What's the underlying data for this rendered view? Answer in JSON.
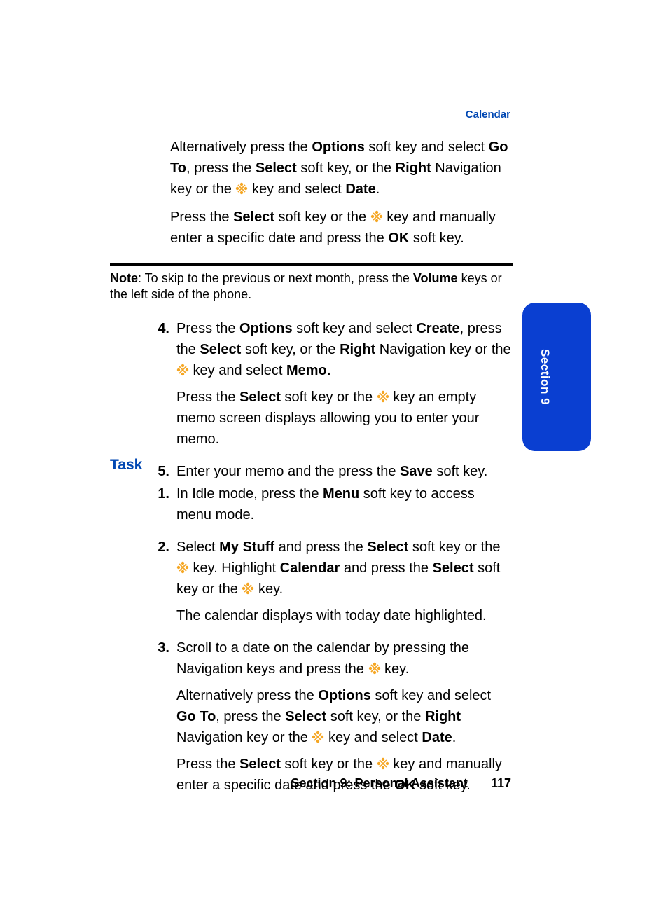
{
  "header": {
    "label": "Calendar"
  },
  "top": {
    "p1a": "Alternatively press the ",
    "p1b": "Options",
    "p1c": " soft key and select ",
    "p1d": "Go To",
    "p1e": ", press the ",
    "p1f": "Select",
    "p1g": " soft key, or the ",
    "p1h": "Right",
    "p1i": " Navigation key or the ",
    "p1j": " key and select ",
    "p1k": "Date",
    "p1l": ".",
    "p2a": "Press the ",
    "p2b": "Select",
    "p2c": " soft key or the ",
    "p2d": " key and manually enter a specific date and press the ",
    "p2e": "OK",
    "p2f": " soft key."
  },
  "note": {
    "label": "Note",
    "a": ": To skip to the previous or next month, press the ",
    "b": "Volume",
    "c": " keys or the left side of the phone."
  },
  "mid": {
    "n4": "4.",
    "s4a": "Press the ",
    "s4b": "Options",
    "s4c": " soft key and select ",
    "s4d": "Create",
    "s4e": ", press the ",
    "s4f": "Select",
    "s4g": " soft key, or the ",
    "s4h": "Right",
    "s4i": " Navigation key or the ",
    "s4j": " key and select ",
    "s4k": "Memo.",
    "s4p2a": "Press the ",
    "s4p2b": "Select",
    "s4p2c": " soft key or the ",
    "s4p2d": " key an empty memo screen displays allowing you to enter your memo.",
    "n5": "5.",
    "s5a": "Enter your memo and the press the ",
    "s5b": "Save",
    "s5c": " soft key."
  },
  "subheading": "Task",
  "bot": {
    "n1": "1.",
    "s1a": "In Idle mode, press the ",
    "s1b": "Menu",
    "s1c": " soft key to access menu mode.",
    "n2": "2.",
    "s2a": "Select ",
    "s2b": "My Stuff",
    "s2c": " and press the ",
    "s2d": "Select",
    "s2e": " soft key or the ",
    "s2f": " key. Highlight ",
    "s2g": "Calendar",
    "s2h": " and press the ",
    "s2i": "Select",
    "s2j": " soft key or the ",
    "s2k": " key.",
    "s2p2": "The calendar displays with today date highlighted.",
    "n3": "3.",
    "s3a": "Scroll to a date on the calendar by pressing the Navigation keys and press the ",
    "s3b": " key.",
    "s3p2a": "Alternatively press the ",
    "s3p2b": "Options",
    "s3p2c": " soft key and select ",
    "s3p2d": "Go To",
    "s3p2e": ", press the ",
    "s3p2f": "Select",
    "s3p2g": " soft key, or the ",
    "s3p2h": "Right",
    "s3p2i": " Navigation key or the ",
    "s3p2j": " key and select ",
    "s3p2k": "Date",
    "s3p2l": ".",
    "s3p3a": "Press the ",
    "s3p3b": "Select",
    "s3p3c": " soft key or the ",
    "s3p3d": " key and manually enter a specific date and press the ",
    "s3p3e": "OK",
    "s3p3f": " soft key."
  },
  "footer": {
    "section": "Section 9: Personal Assistant",
    "page": "117"
  },
  "sidetab": "Section 9"
}
